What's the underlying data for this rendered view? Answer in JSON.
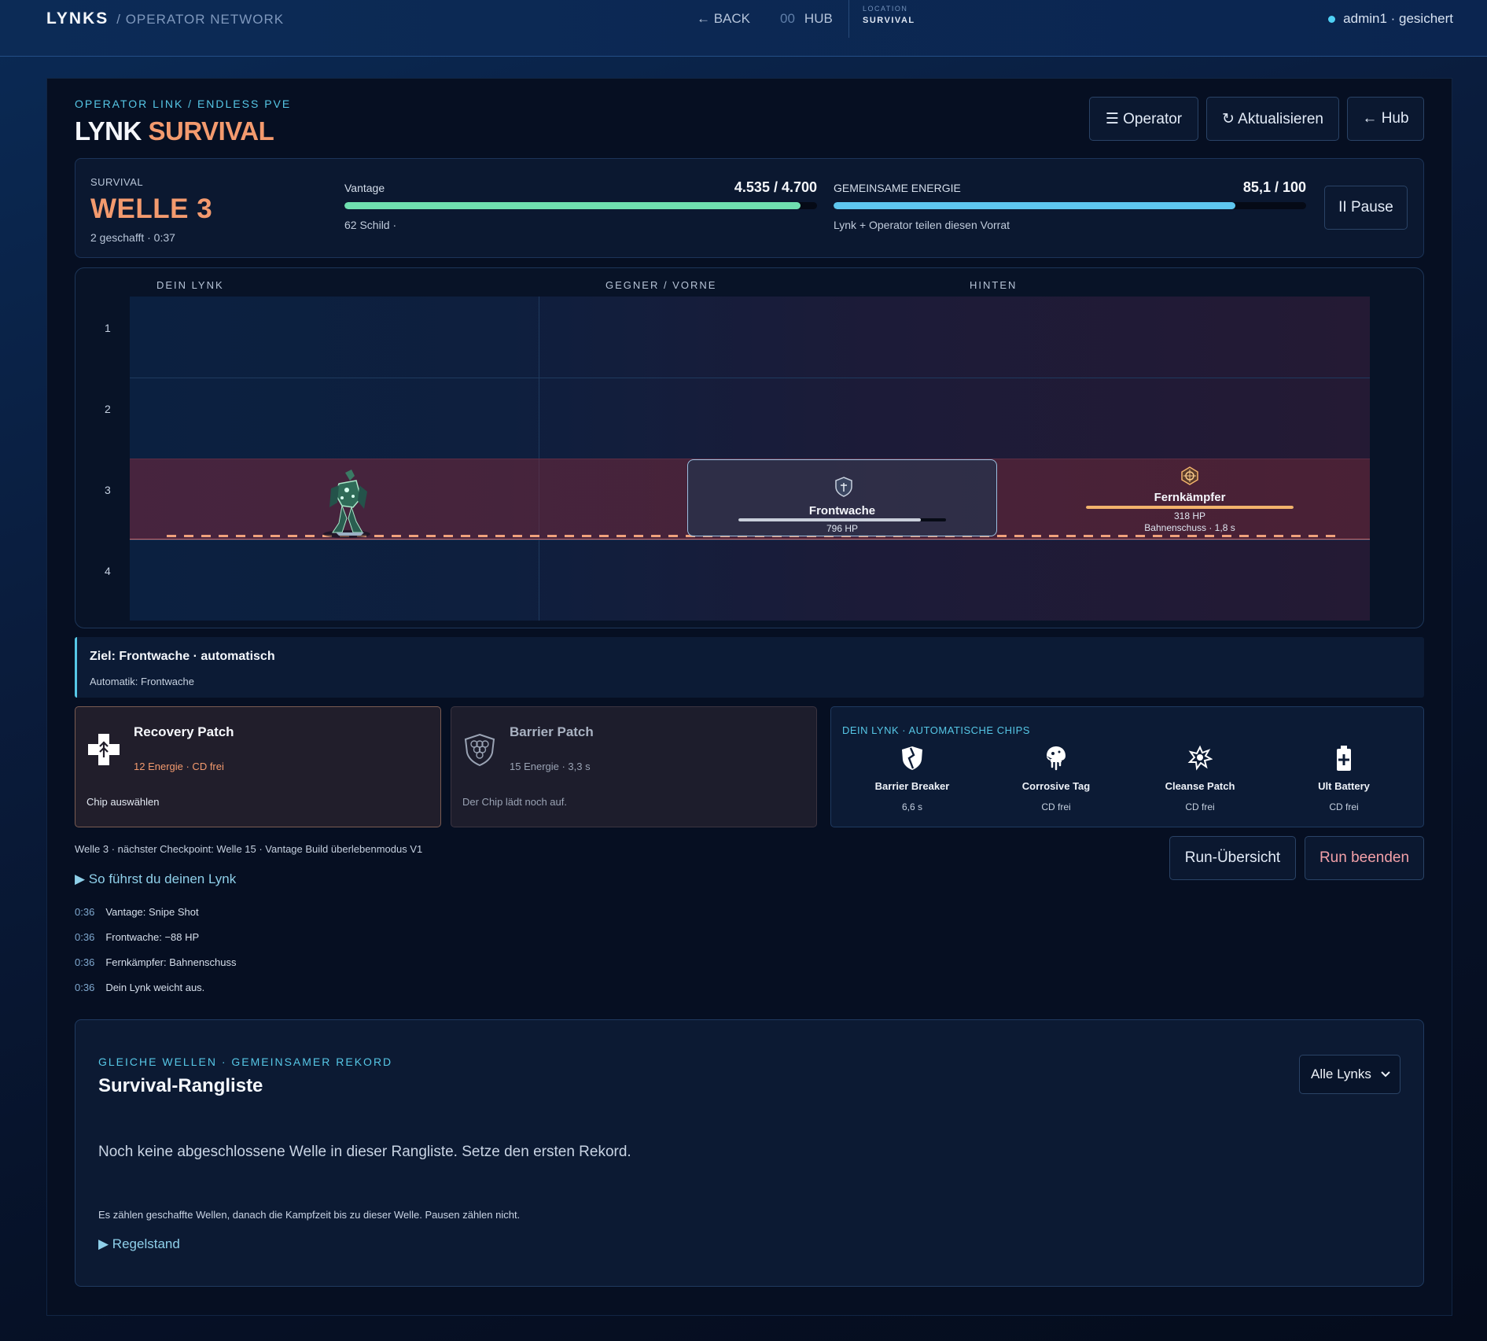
{
  "nav": {
    "brand": "LYNKS",
    "brand_sub": "/ OPERATOR NETWORK",
    "back": "← BACK",
    "hub_num": "00",
    "hub": "HUB",
    "location_label": "LOCATION",
    "location_value": "SURVIVAL",
    "user": "admin1 · gesichert"
  },
  "header": {
    "eyebrow": "OPERATOR LINK / ENDLESS PVE",
    "title_a": "LYNK",
    "title_b": "SURVIVAL",
    "btn_operator": "☰ Operator",
    "btn_refresh": "↻ Aktualisieren",
    "btn_hub": "← Hub"
  },
  "status": {
    "label": "SURVIVAL",
    "wave": "WELLE 3",
    "sub": "2 geschafft · 0:37",
    "vantage": {
      "title": "Vantage",
      "value": "4.535 / 4.700",
      "note": "62 Schild ·",
      "fraction": 0.965,
      "color": "#6fe0b0"
    },
    "energy": {
      "title": "GEMEINSAME ENERGIE",
      "value": "85,1 / 100",
      "note": "Lynk + Operator teilen diesen Vorrat",
      "fraction": 0.851,
      "color": "#5ec6ef"
    },
    "pause": "II Pause"
  },
  "arena": {
    "col_lynk": "DEIN LYNK",
    "col_front": "GEGNER / VORNE",
    "col_rear": "HINTEN",
    "lanes": [
      "1",
      "2",
      "3",
      "4"
    ],
    "front_enemy": {
      "name": "Frontwache",
      "hp": "796 HP",
      "fraction": 0.88,
      "color": "#c9cfdb"
    },
    "rear_enemy": {
      "name": "Fernkämpfer",
      "hp": "318 HP",
      "skill": "Bahnenschuss · 1,8 s",
      "fraction": 1.0,
      "color": "#f2b36c"
    }
  },
  "target": {
    "title": "Ziel: Frontwache · automatisch",
    "sub": "Automatik: Frontwache"
  },
  "chips": [
    {
      "name": "Recovery Patch",
      "cost": "12 Energie · CD frei",
      "foot": "Chip auswählen",
      "icon": "recovery-cross-icon"
    },
    {
      "name": "Barrier Patch",
      "cost": "15 Energie · 3,3 s",
      "foot": "Der Chip lädt noch auf.",
      "icon": "barrier-hex-icon"
    }
  ],
  "auto_chips": {
    "title": "DEIN LYNK · AUTOMATISCHE CHIPS",
    "items": [
      {
        "name": "Barrier Breaker",
        "cd": "6,6 s",
        "icon": "broken-shield-icon"
      },
      {
        "name": "Corrosive Tag",
        "cd": "CD frei",
        "icon": "acid-drip-icon"
      },
      {
        "name": "Cleanse Patch",
        "cd": "CD frei",
        "icon": "cleanse-burst-icon"
      },
      {
        "name": "Ult Battery",
        "cd": "CD frei",
        "icon": "battery-icon"
      }
    ]
  },
  "footer": {
    "checkpoint": "Welle 3 · nächster Checkpoint: Welle 15 · Vantage Build überlebenmodus V1",
    "howto": "▶ So führst du deinen Lynk",
    "btn_overview": "Run-Übersicht",
    "btn_end": "Run beenden"
  },
  "log": [
    {
      "t": "0:36",
      "msg": "Vantage: Snipe Shot"
    },
    {
      "t": "0:36",
      "msg": "Frontwache: −88 HP"
    },
    {
      "t": "0:36",
      "msg": "Fernkämpfer: Bahnenschuss"
    },
    {
      "t": "0:36",
      "msg": "Dein Lynk weicht aus."
    }
  ],
  "board": {
    "eyebrow": "GLEICHE WELLEN · GEMEINSAMER REKORD",
    "title": "Survival-Rangliste",
    "select": "Alle Lynks",
    "empty": "Noch keine abgeschlossene Welle in dieser Rangliste. Setze den ersten Rekord.",
    "note": "Es zählen geschaffte Wellen, danach die Kampfzeit bis zu dieser Welle. Pausen zählen nicht.",
    "rules": "▶ Regelstand"
  }
}
